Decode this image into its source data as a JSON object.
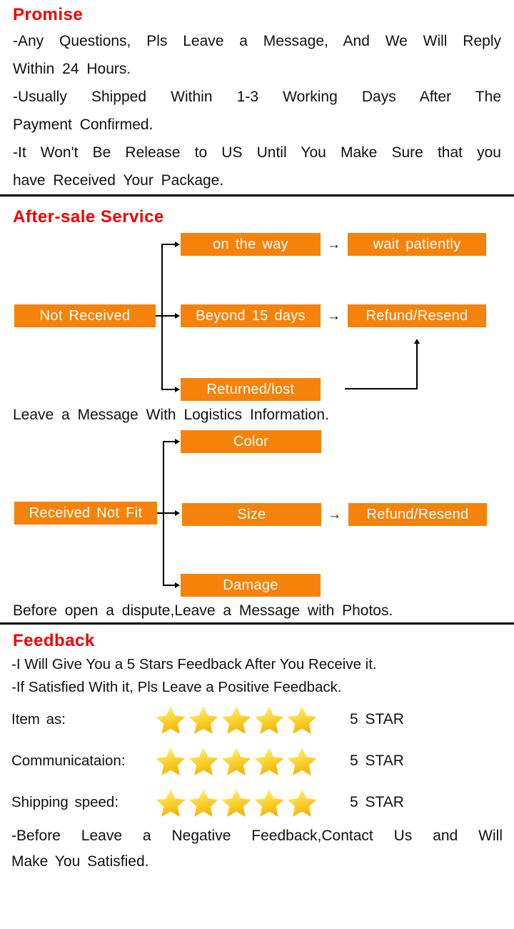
{
  "theme": {
    "heading_color": "#ee0000",
    "box_color": "#f5820b",
    "box_text_color": "#ffffff",
    "text_color": "#111111",
    "rule_color": "#000000",
    "star_color": "#ffd024"
  },
  "promise": {
    "title": "Promise",
    "lines": [
      "-Any  Questions,  Pls  Leave  a  Message,  And We Will Reply",
      "Within  24  Hours.",
      "-Usually  Shipped  Within  1-3  Working  Days  After  The",
      "Payment  Confirmed.",
      "-It  Won't  Be  Release  to  US  Until  You  Make  Sure  that  you",
      "have  Received  Your  Package."
    ]
  },
  "after_sale": {
    "title": "After-sale Service",
    "flow_not_received": {
      "source": "Not  Received",
      "branches": [
        {
          "cause": "on  the  way",
          "result": "wait  patiently"
        },
        {
          "cause": "Beyond  15  days",
          "result": "Refund/Resend"
        },
        {
          "cause": "Returned/lost",
          "result": ""
        }
      ],
      "note": "Leave  a  Message  With  Logistics  Information."
    },
    "flow_not_fit": {
      "source": "Received  Not  Fit",
      "branches": [
        {
          "cause": "Color",
          "result": ""
        },
        {
          "cause": "Size",
          "result": "Refund/Resend"
        },
        {
          "cause": "Damage",
          "result": ""
        }
      ],
      "note": "Before  open  a  dispute,Leave  a  Message  with  Photos."
    },
    "arrow_glyph": "→"
  },
  "feedback": {
    "title": "Feedback",
    "lines": [
      "-I  Will  Give  You  a  5  Stars  Feedback  After  You  Receive  it.",
      "-If  Satisfied  With  it, Pls  Leave  a  Positive  Feedback."
    ],
    "ratings": [
      {
        "label": "Item  as:",
        "stars": 5,
        "value": "5  STAR"
      },
      {
        "label": "Communicataion:",
        "stars": 5,
        "value": "5  STAR"
      },
      {
        "label": "Shipping  speed:",
        "stars": 5,
        "value": "5  STAR"
      }
    ],
    "tail": [
      "-Before  Leave  a  Negative  Feedback,Contact  Us  and  Will",
      "Make  You  Satisfied."
    ]
  }
}
